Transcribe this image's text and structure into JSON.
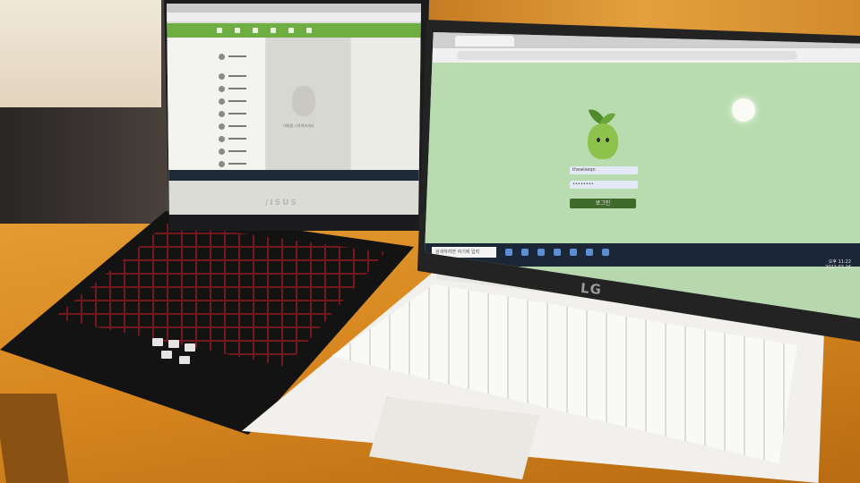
{
  "scene": {
    "asus_laptop": {
      "brand": "/ISUS",
      "chat_caption": "대화를 시작해보세요"
    },
    "lg_laptop": {
      "brand": "LG",
      "login_form": {
        "username_value": "thewiseqn",
        "password_value": "••••••••",
        "login_button": "로그인"
      },
      "taskbar": {
        "search_placeholder": "검색하려면 여기에 입력",
        "time": "오후 11:22",
        "date": "2022-02-26"
      }
    }
  }
}
